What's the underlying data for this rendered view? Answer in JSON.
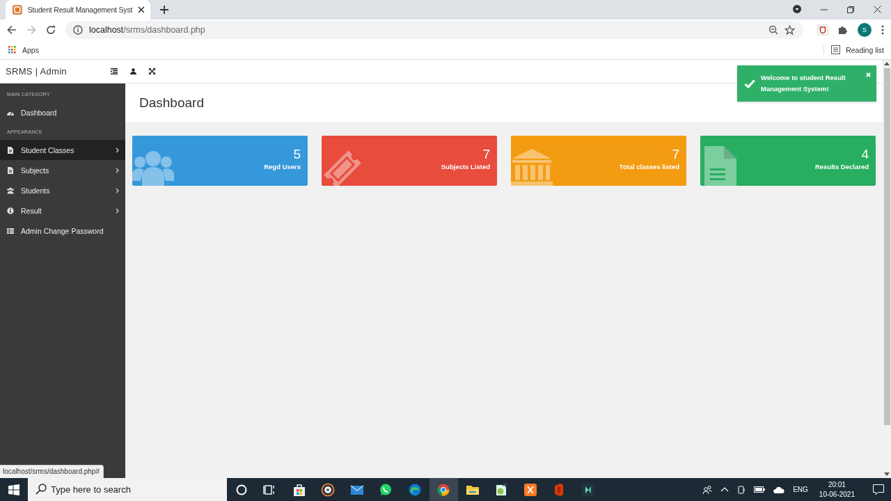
{
  "browser": {
    "tab_title": "Student Result Management Syst",
    "url_host": "localhost",
    "url_path": "/srms/dashboard.php",
    "profile_initial": "S",
    "bookmarks": [
      "Apps"
    ],
    "reading_list": "Reading list",
    "status_url": "localhost/srms/dashboard.php#"
  },
  "header": {
    "brand": "SRMS | Admin"
  },
  "sidebar": {
    "sections": [
      {
        "heading": "MAIN CATEGORY",
        "items": [
          {
            "label": "Dashboard",
            "kind": "dashboard",
            "submenu": false,
            "hovered": false
          }
        ]
      },
      {
        "heading": "APPEARANCE",
        "items": [
          {
            "label": "Student Classes",
            "kind": "file",
            "submenu": true,
            "hovered": true
          },
          {
            "label": "Subjects",
            "kind": "file",
            "submenu": true,
            "hovered": false
          },
          {
            "label": "Students",
            "kind": "users",
            "submenu": true,
            "hovered": false
          },
          {
            "label": "Result",
            "kind": "info",
            "submenu": true,
            "hovered": false
          },
          {
            "label": "Admin Change Password",
            "kind": "table",
            "submenu": false,
            "hovered": false
          }
        ]
      }
    ]
  },
  "page_title": "Dashboard",
  "cards": [
    {
      "value": "5",
      "label": "Regd Users",
      "kind": "users",
      "color": "#3498db"
    },
    {
      "value": "7",
      "label": "Subjects Listed",
      "kind": "ticket",
      "color": "#e74c3c"
    },
    {
      "value": "7",
      "label": "Total classes listed",
      "kind": "bank",
      "color": "#f39c12"
    },
    {
      "value": "4",
      "label": "Results Declared",
      "kind": "file",
      "color": "#27ae60"
    }
  ],
  "toast": {
    "kind": "success",
    "message": "Welcome to student Result Management System!"
  },
  "taskbar": {
    "search_placeholder": "Type here to search",
    "apps": [
      {
        "kind": "cortana",
        "selected": false
      },
      {
        "kind": "taskview",
        "selected": false
      },
      {
        "kind": "store",
        "selected": false
      },
      {
        "kind": "media",
        "selected": false
      },
      {
        "kind": "mail",
        "selected": false
      },
      {
        "kind": "chat",
        "selected": false
      },
      {
        "kind": "edge",
        "selected": false
      },
      {
        "kind": "chrome",
        "selected": true
      },
      {
        "kind": "folder",
        "selected": false
      },
      {
        "kind": "notepad",
        "selected": false
      },
      {
        "kind": "xampp",
        "selected": false
      },
      {
        "kind": "office",
        "selected": false
      },
      {
        "kind": "video",
        "selected": false
      }
    ],
    "language": "ENG",
    "time": "20:01",
    "date": "10-06-2021"
  }
}
